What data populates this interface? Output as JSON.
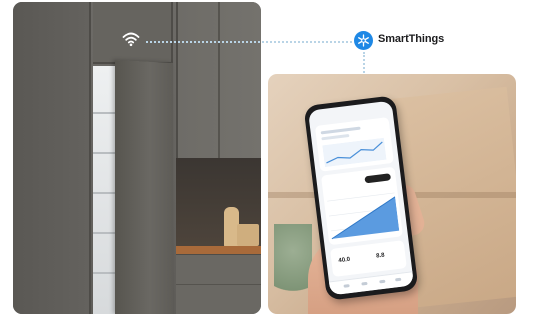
{
  "brand": {
    "name": "SmartThings",
    "logo_icon": "smartthings-snowflake-icon",
    "accent": "#1e88e5"
  },
  "connection": {
    "icon": "wifi-icon",
    "line_color": "#b9d4e6"
  },
  "phone_screen": {
    "readout_left": "40.0",
    "readout_right": "8.8"
  }
}
